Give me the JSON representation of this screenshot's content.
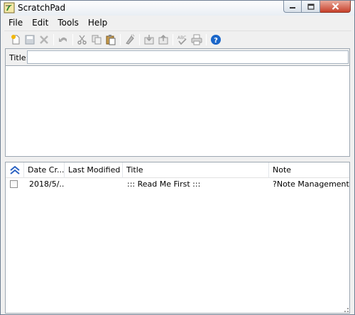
{
  "window": {
    "title": "ScratchPad"
  },
  "menu": [
    "File",
    "Edit",
    "Tools",
    "Help"
  ],
  "toolbar": {
    "icons": [
      "new-note-icon",
      "save-icon",
      "delete-icon",
      "undo-icon",
      "cut-icon",
      "copy-icon",
      "paste-icon",
      "clear-format-icon",
      "import-icon",
      "export-icon",
      "spellcheck-icon",
      "print-icon",
      "help-icon"
    ]
  },
  "title_field": {
    "label": "Title:",
    "value": ""
  },
  "list": {
    "columns": [
      "Date Cr...",
      "Last Modified",
      "Title",
      "Note"
    ],
    "rows": [
      {
        "checked": false,
        "date_created": "2018/5/...",
        "last_modified": "",
        "title": "::: Read Me First :::",
        "note": "?Note Management.?R"
      }
    ]
  },
  "colors": {
    "help_blue": "#1a66c9",
    "sort_arrow": "#2b62c2"
  }
}
